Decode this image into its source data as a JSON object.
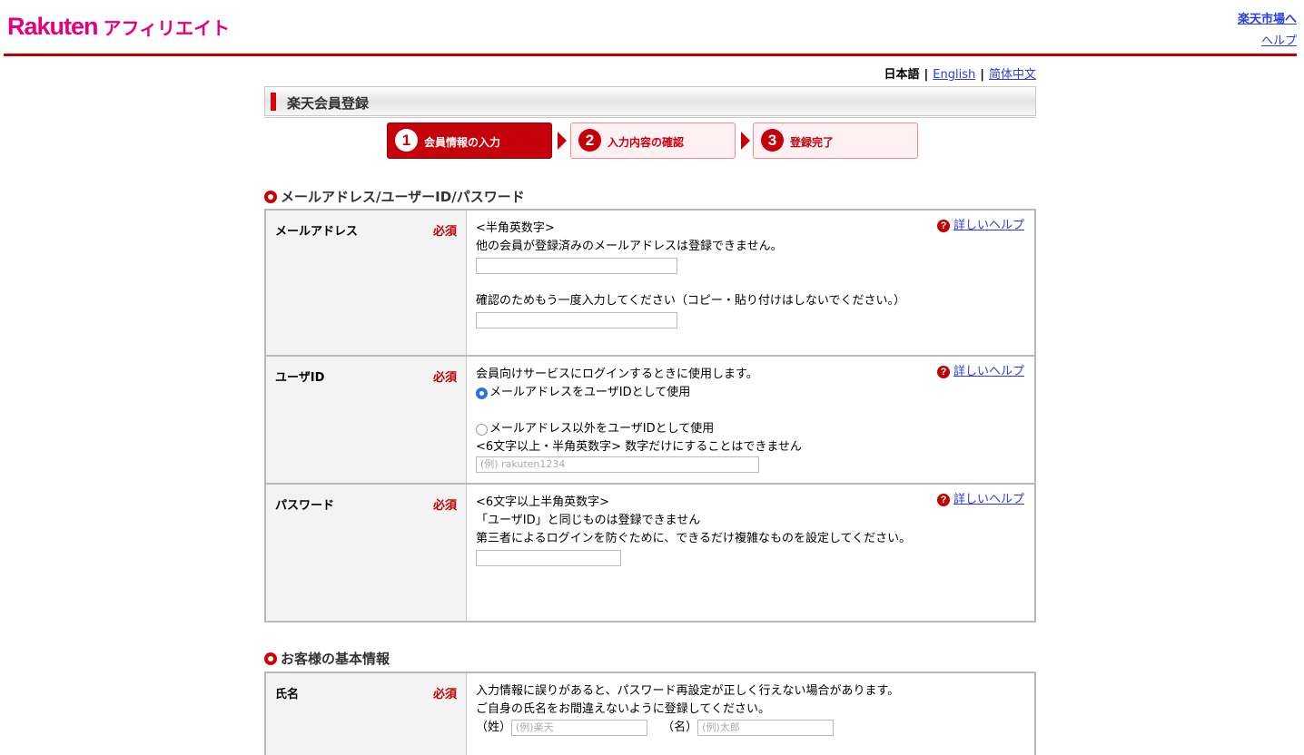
{
  "header": {
    "logo_rakuten": "Rakuten",
    "logo_affiliate": "アフィリエイト",
    "link_ichiba": "楽天市場へ",
    "link_help": "ヘルプ"
  },
  "lang": {
    "current": "日本語",
    "english": "English",
    "chinese": "简体中文"
  },
  "page_title": "楽天会員登録",
  "steps": [
    {
      "num": "1",
      "label": "会員情報の入力",
      "active": true
    },
    {
      "num": "2",
      "label": "入力内容の確認",
      "active": false
    },
    {
      "num": "3",
      "label": "登録完了",
      "active": false
    }
  ],
  "section1": {
    "heading": "メールアドレス/ユーザーID/パスワード",
    "required": "必須",
    "help": "詳しいヘルプ",
    "email": {
      "label": "メールアドレス",
      "note1": "<半角英数字>",
      "note2": "他の会員が登録済みのメールアドレスは登録できません。",
      "confirm": "確認のためもう一度入力してください（コピー・貼り付けはしないでください。）"
    },
    "userid": {
      "label": "ユーザID",
      "note": "会員向けサービスにログインするときに使用します。",
      "option1": "メールアドレスをユーザIDとして使用",
      "option2": "メールアドレス以外をユーザIDとして使用",
      "note2": "<6文字以上・半角英数字> 数字だけにすることはできません",
      "placeholder": "(例) rakuten1234"
    },
    "password": {
      "label": "パスワード",
      "note1": "<6文字以上半角英数字>",
      "note2": "「ユーザID」と同じものは登録できません",
      "note3": "第三者によるログインを防ぐために、できるだけ複雑なものを設定してください。"
    }
  },
  "section2": {
    "heading": "お客様の基本情報",
    "name": {
      "label": "氏名",
      "note1": "入力情報に誤りがあると、パスワード再設定が正しく行えない場合があります。",
      "note2": "ご自身の氏名をお間違えないように登録してください。",
      "sei_label": "（姓）",
      "sei_placeholder": "(例)楽天",
      "mei_label": "（名）",
      "mei_placeholder": "(例)太郎"
    }
  }
}
